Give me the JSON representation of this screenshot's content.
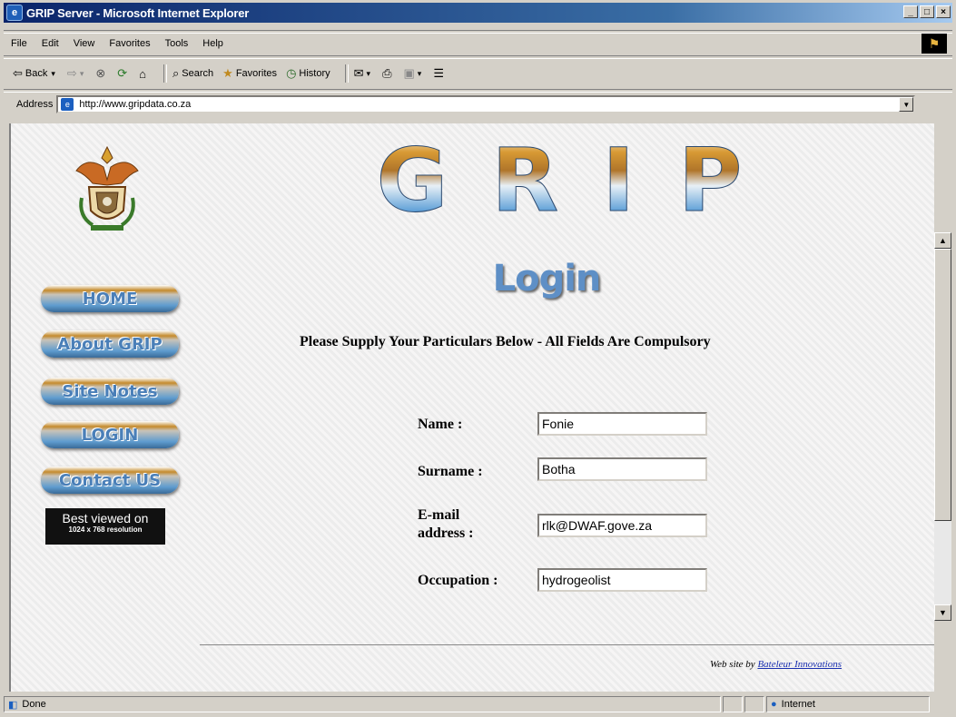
{
  "window": {
    "title": "GRIP Server - Microsoft Internet Explorer",
    "controls": [
      "_",
      "□",
      "×"
    ]
  },
  "menu": [
    "File",
    "Edit",
    "View",
    "Favorites",
    "Tools",
    "Help"
  ],
  "toolbar": {
    "back": "Back",
    "search": "Search",
    "favorites": "Favorites",
    "history": "History"
  },
  "address": {
    "label": "Address",
    "url": "http://www.gripdata.co.za"
  },
  "page": {
    "logo_text": "GRIP",
    "heading": "Login",
    "instructions": "Please Supply Your Particulars Below - All Fields Are Compulsory",
    "nav": [
      "HOME",
      "About GRIP",
      "Site Notes",
      "LOGIN",
      "Contact US"
    ],
    "badge": {
      "line1": "Best viewed on",
      "line2": "1024 x 768 resolution"
    },
    "form": {
      "name_label": "Name :",
      "name_value": "Fonie",
      "surname_label": "Surname :",
      "surname_value": "Botha",
      "email_label_1": "E-mail",
      "email_label_2": "address :",
      "email_value": "rlk@DWAF.gove.za",
      "occupation_label": "Occupation :",
      "occupation_value": "hydrogeolist"
    },
    "credit": {
      "prefix": "Web site by",
      "link": "Bateleur Innovations"
    }
  },
  "status": {
    "text": "Done",
    "zone": "Internet"
  }
}
